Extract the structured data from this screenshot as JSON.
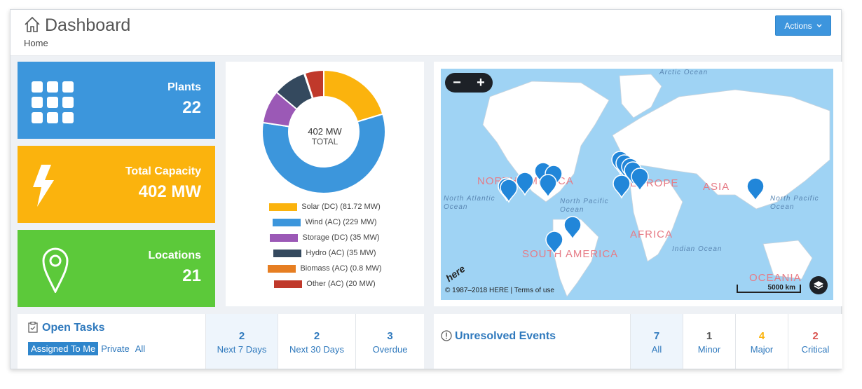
{
  "header": {
    "title": "Dashboard",
    "breadcrumb": "Home",
    "actions_label": "Actions"
  },
  "stat_cards": {
    "plants": {
      "label": "Plants",
      "value": "22"
    },
    "capacity": {
      "label": "Total Capacity",
      "value": "402 MW"
    },
    "locations": {
      "label": "Locations",
      "value": "21"
    }
  },
  "donut": {
    "center_value": "402 MW",
    "center_label": "TOTAL",
    "legend": [
      {
        "label": "Solar (DC) (81.72 MW)",
        "color": "#fbb30d"
      },
      {
        "label": "Wind (AC) (229 MW)",
        "color": "#3c96dc"
      },
      {
        "label": "Storage (DC) (35 MW)",
        "color": "#9b59b6"
      },
      {
        "label": "Hydro (AC) (35 MW)",
        "color": "#34495e"
      },
      {
        "label": "Biomass (AC) (0.8 MW)",
        "color": "#e67e22"
      },
      {
        "label": "Other (AC) (20 MW)",
        "color": "#c0392b"
      }
    ]
  },
  "chart_data": {
    "type": "pie",
    "categories": [
      "Solar (DC)",
      "Wind (AC)",
      "Storage (DC)",
      "Hydro (AC)",
      "Biomass (AC)",
      "Other (AC)"
    ],
    "values": [
      81.72,
      229,
      35,
      35,
      0.8,
      20
    ],
    "colors": [
      "#fbb30d",
      "#3c96dc",
      "#9b59b6",
      "#34495e",
      "#e67e22",
      "#c0392b"
    ]
  },
  "map": {
    "zoom_out": "−",
    "zoom_in": "+",
    "copyright": "© 1987–2018 HERE | Terms of use",
    "scale": "5000 km",
    "brand": "here",
    "continents": [
      "NORTH AMERICA",
      "EUROPE",
      "ASIA",
      "AFRICA",
      "SOUTH AMERICA",
      "OCEANIA"
    ],
    "oceans": [
      "Arctic Ocean",
      "North Atlantic Ocean",
      "North Pacific Ocean",
      "Indian Ocean",
      "North Pacific Ocean"
    ]
  },
  "tasks": {
    "title": "Open Tasks",
    "filters": [
      "Assigned To Me",
      "Private",
      "All"
    ],
    "stats": [
      {
        "num": "2",
        "label": "Next 7 Days"
      },
      {
        "num": "2",
        "label": "Next 30 Days"
      },
      {
        "num": "3",
        "label": "Overdue"
      }
    ]
  },
  "events": {
    "title": "Unresolved Events",
    "stats": [
      {
        "num": "7",
        "label": "All",
        "color": "#2f79bd"
      },
      {
        "num": "1",
        "label": "Minor",
        "color": "#555555"
      },
      {
        "num": "4",
        "label": "Major",
        "color": "#fbb30d"
      },
      {
        "num": "2",
        "label": "Critical",
        "color": "#d9534f"
      }
    ]
  }
}
